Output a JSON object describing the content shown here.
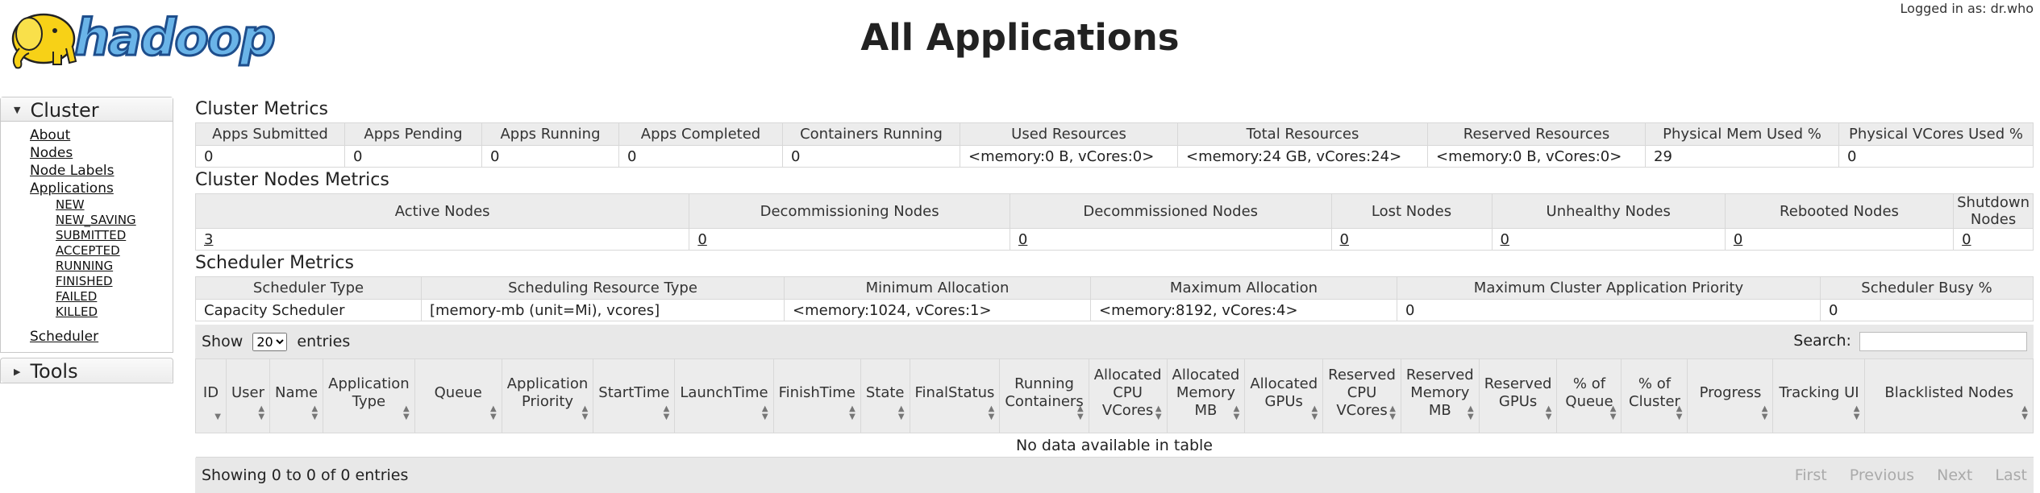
{
  "header": {
    "logo_text": "hadoop",
    "title": "All Applications",
    "logged_in": "Logged in as: dr.who"
  },
  "nav": {
    "cluster_label": "Cluster",
    "items": [
      "About",
      "Nodes",
      "Node Labels",
      "Applications"
    ],
    "app_states": [
      "NEW",
      "NEW_SAVING",
      "SUBMITTED",
      "ACCEPTED",
      "RUNNING",
      "FINISHED",
      "FAILED",
      "KILLED"
    ],
    "scheduler": "Scheduler",
    "tools_label": "Tools"
  },
  "cluster_metrics": {
    "title": "Cluster Metrics",
    "headers": [
      "Apps Submitted",
      "Apps Pending",
      "Apps Running",
      "Apps Completed",
      "Containers Running",
      "Used Resources",
      "Total Resources",
      "Reserved Resources",
      "Physical Mem Used %",
      "Physical VCores Used %"
    ],
    "values": [
      "0",
      "0",
      "0",
      "0",
      "0",
      "<memory:0 B, vCores:0>",
      "<memory:24 GB, vCores:24>",
      "<memory:0 B, vCores:0>",
      "29",
      "0"
    ]
  },
  "node_metrics": {
    "title": "Cluster Nodes Metrics",
    "headers": [
      "Active Nodes",
      "Decommissioning Nodes",
      "Decommissioned Nodes",
      "Lost Nodes",
      "Unhealthy Nodes",
      "Rebooted Nodes",
      "Shutdown Nodes"
    ],
    "values": [
      "3",
      "0",
      "0",
      "0",
      "0",
      "0",
      "0"
    ]
  },
  "scheduler_metrics": {
    "title": "Scheduler Metrics",
    "headers": [
      "Scheduler Type",
      "Scheduling Resource Type",
      "Minimum Allocation",
      "Maximum Allocation",
      "Maximum Cluster Application Priority",
      "Scheduler Busy %"
    ],
    "values": [
      "Capacity Scheduler",
      "[memory-mb (unit=Mi), vcores]",
      "<memory:1024, vCores:1>",
      "<memory:8192, vCores:4>",
      "0",
      "0"
    ]
  },
  "apps_table": {
    "show_label": "Show",
    "entries_label": "entries",
    "page_size": "20",
    "search_label": "Search:",
    "columns": [
      "ID",
      "User",
      "Name",
      "Application Type",
      "Queue",
      "Application Priority",
      "StartTime",
      "LaunchTime",
      "FinishTime",
      "State",
      "FinalStatus",
      "Running Containers",
      "Allocated CPU VCores",
      "Allocated Memory MB",
      "Allocated GPUs",
      "Reserved CPU VCores",
      "Reserved Memory MB",
      "Reserved GPUs",
      "% of Queue",
      "% of Cluster",
      "Progress",
      "Tracking UI",
      "Blacklisted Nodes"
    ],
    "empty_message": "No data available in table",
    "info": "Showing 0 to 0 of 0 entries",
    "pager": [
      "First",
      "Previous",
      "Next",
      "Last"
    ]
  },
  "colors": {
    "header_bg": "#ececec",
    "border": "#d8d8d8",
    "logo_yellow": "#f7d117",
    "logo_blue": "#1e4e8c"
  }
}
